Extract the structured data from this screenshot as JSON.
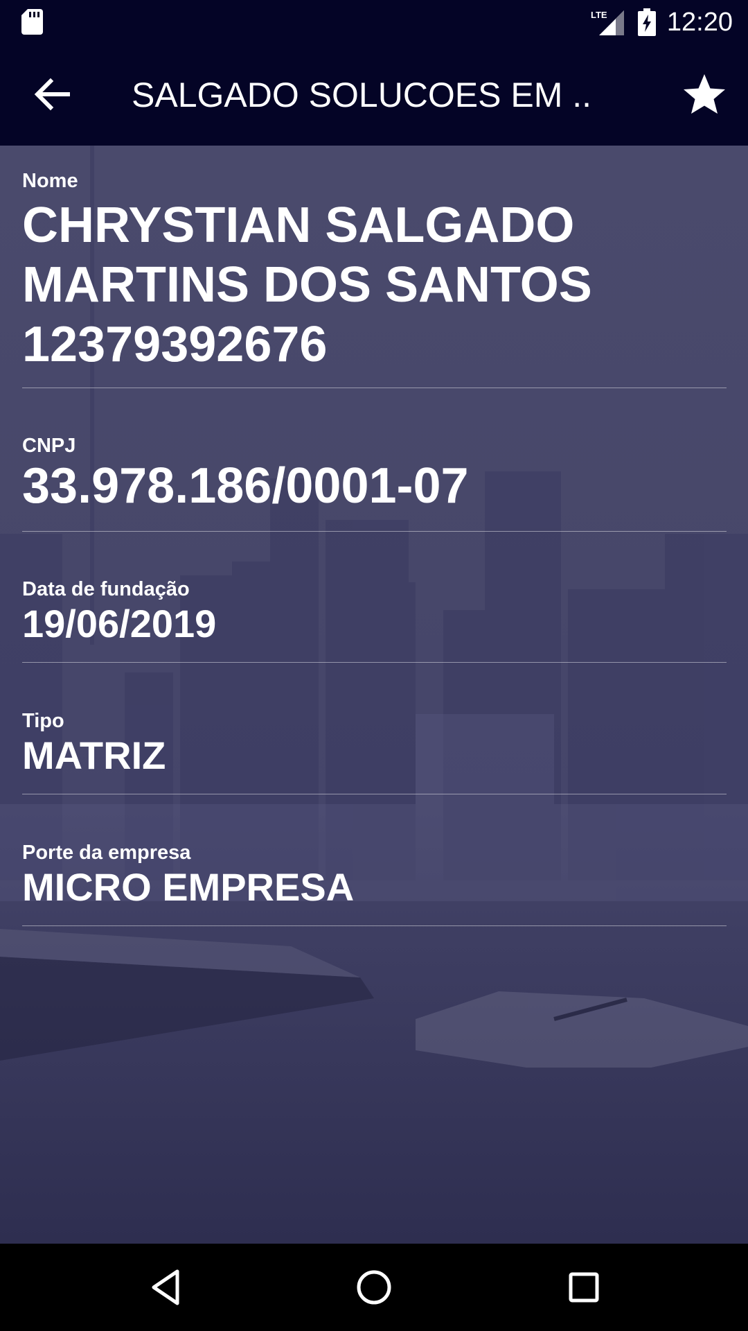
{
  "status_bar": {
    "clock": "12:20",
    "network_label": "LTE",
    "icons": [
      "sd-card-icon",
      "signal-icon",
      "battery-charging-icon"
    ]
  },
  "app_bar": {
    "title": "SALGADO SOLUCOES EM ...",
    "icons": [
      "arrow-back-icon",
      "star-icon"
    ]
  },
  "fields": {
    "nome": {
      "label": "Nome",
      "lines": [
        "CHRYSTIAN SALGADO",
        "MARTINS DOS SANTOS",
        "12379392676"
      ]
    },
    "cnpj": {
      "label": "CNPJ",
      "value": "33.978.186/0001-07"
    },
    "data_fundacao": {
      "label": "Data de fundação",
      "value": "19/06/2019"
    },
    "tipo": {
      "label": "Tipo",
      "value": "MATRIZ"
    },
    "porte": {
      "label": "Porte da empresa",
      "value": "MICRO EMPRESA"
    }
  },
  "nav_bar": {
    "icons": [
      "nav-back-icon",
      "home-icon",
      "recents-icon"
    ]
  },
  "colors": {
    "app_bar": "#040426",
    "overlay": "#47476a",
    "text": "#ffffff"
  }
}
